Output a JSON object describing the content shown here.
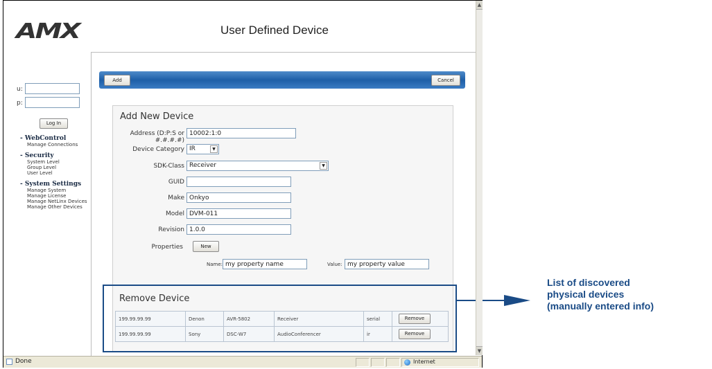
{
  "header": {
    "logo_text": "AMX",
    "title": "User Defined Device"
  },
  "login": {
    "user_label": "u:",
    "pass_label": "p:",
    "login_button": "Log In"
  },
  "nav": {
    "webcontrol_heading": "- WebControl",
    "webcontrol_items": [
      "Manage Connections"
    ],
    "security_heading": "- Security",
    "security_items": [
      "System Level",
      "Group Level",
      "User Level"
    ],
    "system_heading": "- System Settings",
    "system_items": [
      "Manage System",
      "Manage License",
      "Manage NetLinx Devices",
      "Manage Other Devices"
    ]
  },
  "toolbar": {
    "add_label": "Add",
    "cancel_label": "Cancel"
  },
  "add_device": {
    "heading": "Add New Device",
    "address_label": "Address (D:P:S or #.#.#.#)",
    "address_value": "10002:1:0",
    "category_label": "Device Category",
    "category_value": "IR",
    "sdk_label": "SDK-Class",
    "sdk_value": "Receiver",
    "guid_label": "GUID",
    "guid_value": "",
    "make_label": "Make",
    "make_value": "Onkyo",
    "model_label": "Model",
    "model_value": "DVM-011",
    "revision_label": "Revision",
    "revision_value": "1.0.0",
    "properties_label": "Properties",
    "new_button": "New",
    "name_label": "Name:",
    "name_value": "my property name",
    "value_label": "Value:",
    "value_value": "my property value"
  },
  "remove_device": {
    "heading": "Remove Device",
    "rows": [
      {
        "address": "199.99.99.99",
        "make": "Denon",
        "model": "AVR-5802",
        "sdk": "Receiver",
        "category": "serial",
        "button": "Remove"
      },
      {
        "address": "199.99.99.99",
        "make": "Sony",
        "model": "DSC-W7",
        "sdk": "AudioConferencer",
        "category": "ir",
        "button": "Remove"
      }
    ]
  },
  "statusbar": {
    "status": "Done",
    "zone": "Internet"
  },
  "callout": {
    "line1": "List of discovered",
    "line2": "physical devices",
    "line3": "(manually entered info)"
  },
  "colors": {
    "accent": "#1a4b86",
    "bar_blue": "#2f6fb8"
  },
  "icons": {
    "status_page": "page-icon",
    "zone": "globe-icon"
  }
}
